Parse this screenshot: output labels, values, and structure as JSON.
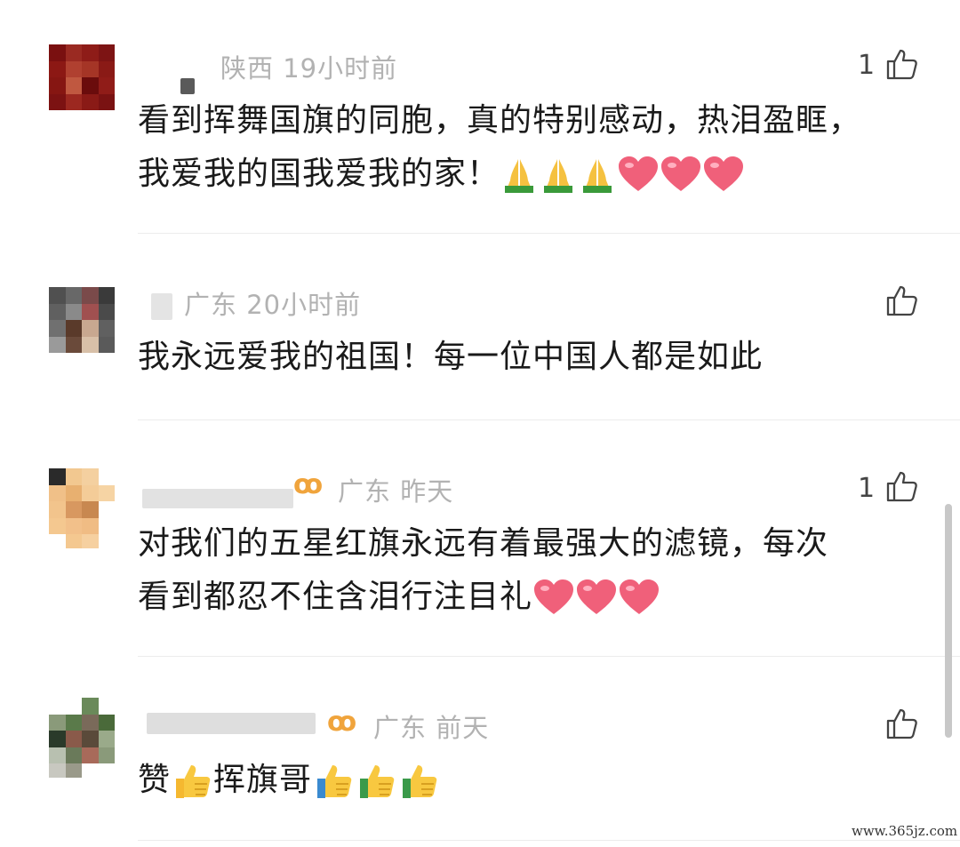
{
  "comments": [
    {
      "region": "陕西",
      "time": "19小时前",
      "like_count": "1",
      "text_line1": "看到挥舞国旗的同胞，真的特别感动，热泪盈眶，",
      "text_line2": "我爱我的国我爱我的家！",
      "emojis_line2": [
        "pray-emoji",
        "pray-emoji",
        "pray-emoji",
        "heart-emoji",
        "heart-emoji",
        "heart-emoji"
      ]
    },
    {
      "region": "广东",
      "time": "20小时前",
      "like_count": "",
      "text_line1": "我永远爱我的祖国！每一位中国人都是如此"
    },
    {
      "region": "广东",
      "time": "昨天",
      "like_count": "1",
      "text_line1": "对我们的五星红旗永远有着最强大的滤镜，每次",
      "text_line2": "看到都忍不住含泪行注目礼",
      "emojis_line2": [
        "heart-emoji",
        "heart-emoji",
        "heart-emoji"
      ]
    },
    {
      "region": "广东",
      "time": "前天",
      "like_count": "",
      "text_prefix": "赞",
      "text_middle": "挥旗哥",
      "emojis": [
        "thumbs-up-emoji",
        "thumbs-up-emoji",
        "thumbs-up-emoji",
        "thumbs-up-emoji"
      ]
    }
  ],
  "watermark": "www.365jz.com",
  "colors": {
    "meta_text": "#b2b2b2",
    "body_text": "#1a1a1a",
    "heart": "#f0607a",
    "vip": "#f0a43c"
  }
}
